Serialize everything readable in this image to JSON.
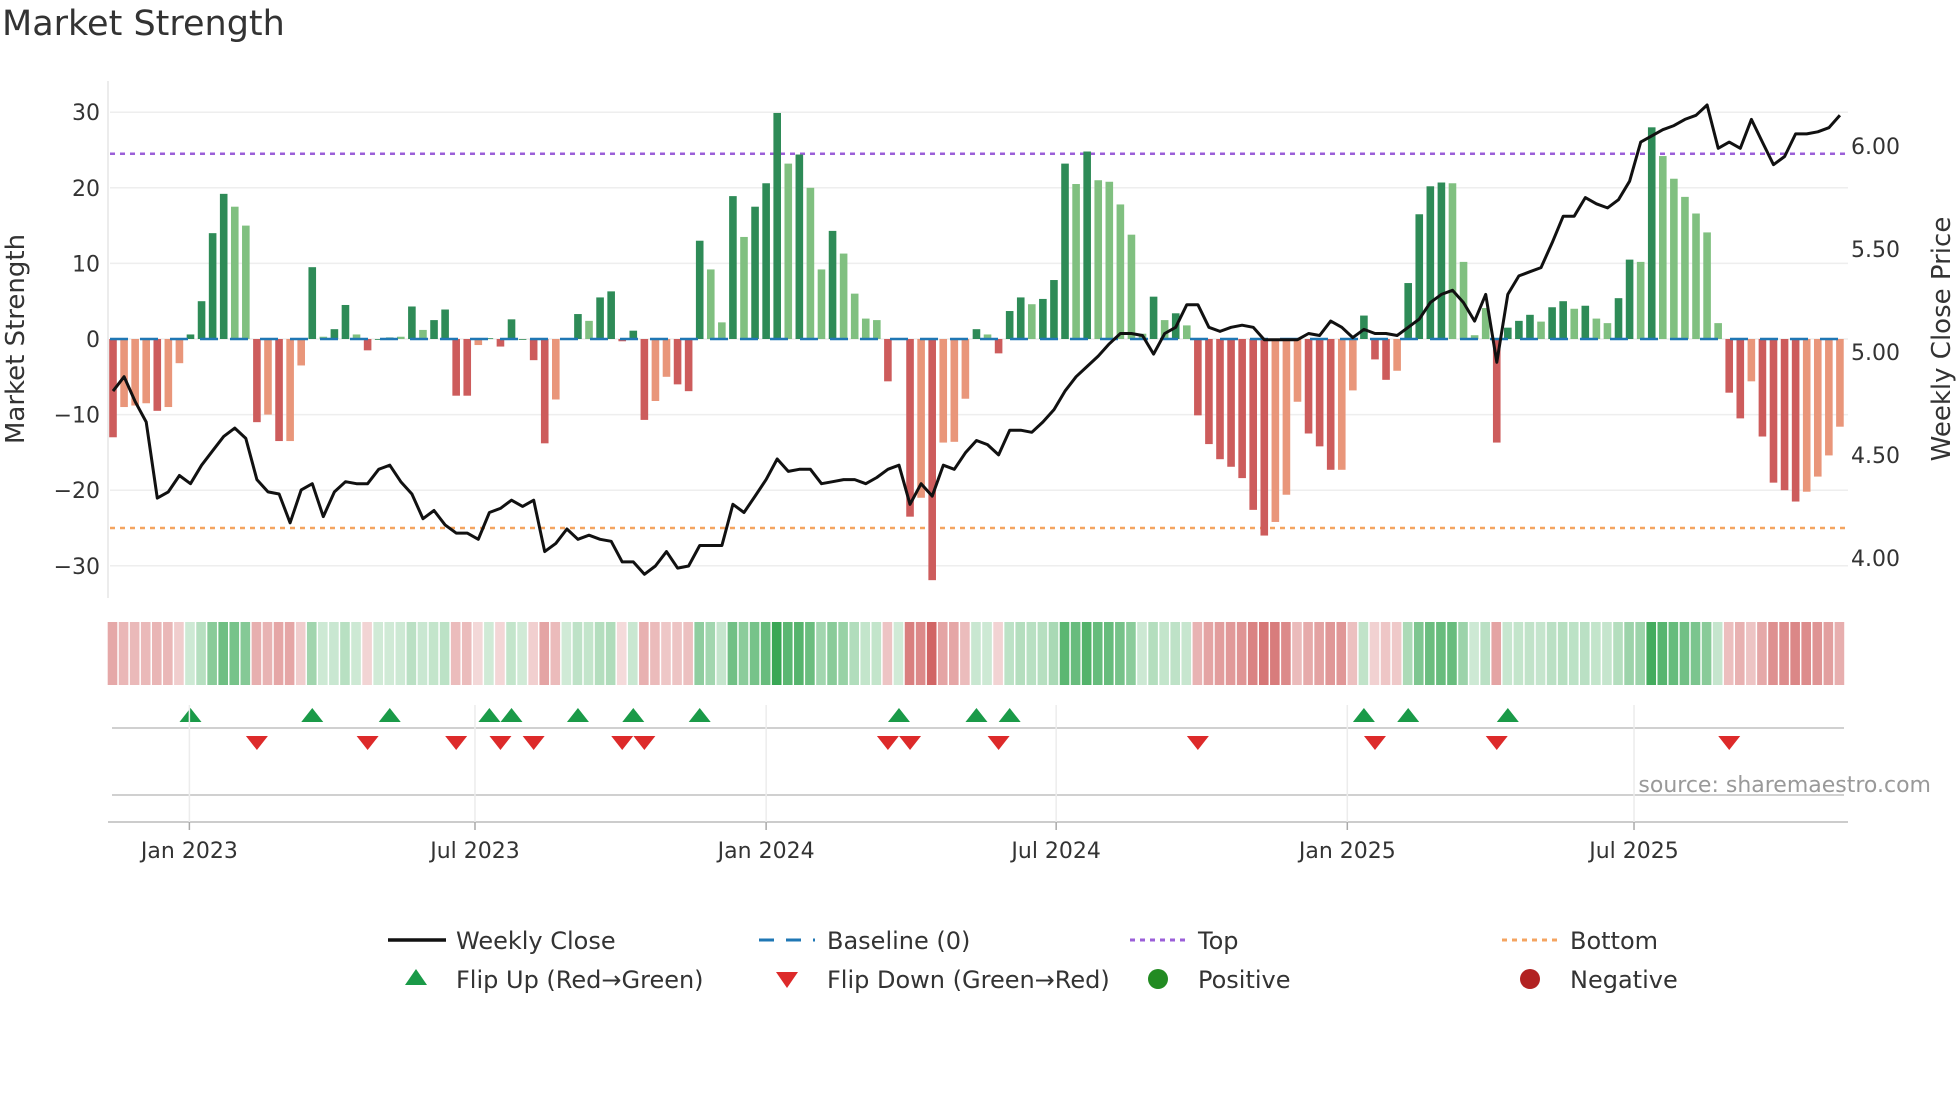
{
  "title": "Market Strength",
  "source": "source: sharemaestro.com",
  "chart_data": {
    "type": "bar",
    "title": "Market Strength",
    "ylabel": "Market Strength",
    "y2label": "Weekly Close Price",
    "ylim": [
      -33,
      33
    ],
    "y2lim": [
      3.9,
      6.3
    ],
    "yticks": [
      -30,
      -20,
      -10,
      0,
      10,
      20,
      30
    ],
    "y2ticks": [
      "4.00",
      "4.50",
      "5.00",
      "5.50",
      "6.00"
    ],
    "xticks": [
      {
        "label": "Jan 2023",
        "week": 6.9
      },
      {
        "label": "Jul 2023",
        "week": 32.7
      },
      {
        "label": "Jan 2024",
        "week": 59.0
      },
      {
        "label": "Jul 2024",
        "week": 85.2
      },
      {
        "label": "Jan 2025",
        "week": 111.5
      },
      {
        "label": "Jul 2025",
        "week": 137.4
      }
    ],
    "top_level": 24.5,
    "bottom_level": -25,
    "strength": [
      -13,
      -9,
      -8.8,
      -8.5,
      -9.5,
      -9,
      -3.2,
      0.6,
      5,
      14,
      19.2,
      17.5,
      15,
      -11,
      -10,
      -13.5,
      -13.5,
      -3.5,
      9.5,
      0.3,
      1.3,
      4.5,
      0.6,
      -1.5,
      0,
      0.2,
      0.3,
      4.3,
      1.2,
      2.5,
      3.9,
      -7.5,
      -7.5,
      -0.8,
      0.1,
      -1,
      2.6,
      0,
      -2.8,
      -13.8,
      -8,
      0,
      3.3,
      2.4,
      5.5,
      6.3,
      -0.3,
      1.1,
      -10.7,
      -8.2,
      -5,
      -6,
      -6.9,
      13,
      9.2,
      2.2,
      18.9,
      13.5,
      17.5,
      20.6,
      29.9,
      23.2,
      24.4,
      20,
      9.2,
      14.3,
      11.3,
      6,
      2.7,
      2.5,
      -5.6,
      0,
      -23.5,
      -21,
      -31.9,
      -13.7,
      -13.6,
      -7.9,
      1.3,
      0.6,
      -1.9,
      3.7,
      5.5,
      4.6,
      5.3,
      7.8,
      23.2,
      20.5,
      24.8,
      21,
      20.8,
      17.8,
      13.8,
      0.7,
      5.6,
      2.5,
      3.4,
      1.8,
      -10.1,
      -13.9,
      -15.9,
      -16.9,
      -18.4,
      -22.6,
      -26,
      -24.2,
      -20.6,
      -8.3,
      -12.5,
      -14.2,
      -17.3,
      -17.3,
      -6.8,
      3.1,
      -2.7,
      -5.4,
      -4.2,
      7.4,
      16.5,
      20.2,
      20.7,
      20.6,
      10.2,
      0.5,
      4.1,
      -13.7,
      1.5,
      2.4,
      3.2,
      2.3,
      4.2,
      5,
      4,
      4.4,
      2.7,
      2.1,
      5.4,
      10.5,
      10.2,
      28,
      24.2,
      21.2,
      18.8,
      16.6,
      14.1,
      2.1,
      -7.1,
      -10.5,
      -5.6,
      -12.9,
      -19,
      -20,
      -21.5,
      -20.2,
      -18.2,
      -15.4,
      -11.6
    ],
    "strong": [
      1,
      0,
      0,
      0,
      1,
      0,
      0,
      1,
      1,
      1,
      1,
      0,
      0,
      1,
      0,
      1,
      0,
      0,
      1,
      0,
      1,
      1,
      0,
      1,
      1,
      1,
      0,
      1,
      0,
      1,
      1,
      1,
      1,
      0,
      1,
      1,
      1,
      1,
      1,
      1,
      0,
      1,
      1,
      0,
      1,
      1,
      1,
      1,
      1,
      0,
      0,
      1,
      1,
      1,
      0,
      0,
      1,
      0,
      1,
      1,
      1,
      0,
      1,
      0,
      0,
      1,
      0,
      0,
      0,
      0,
      1,
      1,
      1,
      0,
      1,
      0,
      0,
      0,
      1,
      0,
      1,
      1,
      1,
      0,
      1,
      1,
      1,
      0,
      1,
      0,
      0,
      0,
      0,
      0,
      1,
      0,
      1,
      0,
      1,
      1,
      1,
      1,
      1,
      1,
      1,
      0,
      0,
      0,
      1,
      1,
      1,
      0,
      0,
      1,
      1,
      1,
      0,
      1,
      1,
      1,
      1,
      0,
      0,
      0,
      0,
      1,
      1,
      1,
      1,
      0,
      1,
      1,
      0,
      1,
      0,
      0,
      1,
      1,
      0,
      1,
      0,
      0,
      0,
      0,
      0,
      0,
      1,
      1,
      0,
      1,
      1,
      1,
      1,
      0,
      0,
      0,
      0
    ],
    "weekly_close": [
      4.81,
      4.88,
      4.76,
      4.66,
      4.29,
      4.32,
      4.4,
      4.36,
      4.45,
      4.52,
      4.59,
      4.63,
      4.58,
      4.38,
      4.32,
      4.31,
      4.17,
      4.33,
      4.36,
      4.2,
      4.32,
      4.37,
      4.36,
      4.36,
      4.43,
      4.45,
      4.37,
      4.31,
      4.19,
      4.23,
      4.16,
      4.12,
      4.12,
      4.09,
      4.22,
      4.24,
      4.28,
      4.25,
      4.28,
      4.03,
      4.07,
      4.14,
      4.09,
      4.11,
      4.09,
      4.08,
      3.98,
      3.98,
      3.92,
      3.96,
      4.03,
      3.95,
      3.96,
      4.06,
      4.06,
      4.06,
      4.26,
      4.22,
      4.3,
      4.38,
      4.48,
      4.42,
      4.43,
      4.43,
      4.36,
      4.37,
      4.38,
      4.38,
      4.36,
      4.39,
      4.43,
      4.45,
      4.26,
      4.36,
      4.3,
      4.45,
      4.43,
      4.51,
      4.57,
      4.55,
      4.5,
      4.62,
      4.62,
      4.61,
      4.66,
      4.72,
      4.81,
      4.88,
      4.93,
      4.98,
      5.04,
      5.09,
      5.09,
      5.08,
      4.99,
      5.09,
      5.12,
      5.23,
      5.23,
      5.12,
      5.1,
      5.12,
      5.13,
      5.12,
      5.06,
      5.06,
      5.06,
      5.06,
      5.09,
      5.08,
      5.15,
      5.12,
      5.07,
      5.11,
      5.09,
      5.09,
      5.08,
      5.12,
      5.16,
      5.24,
      5.28,
      5.3,
      5.24,
      5.15,
      5.28,
      4.95,
      5.28,
      5.37,
      5.39,
      5.41,
      5.53,
      5.66,
      5.66,
      5.75,
      5.72,
      5.7,
      5.74,
      5.83,
      6.02,
      6.05,
      6.08,
      6.1,
      6.13,
      6.15,
      6.2,
      5.99,
      6.02,
      5.99,
      6.13,
      6.02,
      5.91,
      5.95,
      6.06,
      6.06,
      6.07,
      6.09,
      6.15
    ],
    "flip_up_weeks": [
      7,
      18,
      25,
      34,
      36,
      42,
      47,
      53,
      71,
      78,
      81,
      113,
      117,
      126
    ],
    "flip_down_weeks": [
      13,
      23,
      31,
      35,
      38,
      46,
      48,
      70,
      72,
      80,
      98,
      114,
      125,
      146
    ],
    "legend": {
      "position": "bottom",
      "items": [
        {
          "label": "Weekly Close",
          "symbol": "line"
        },
        {
          "label": "Baseline (0)",
          "symbol": "dash"
        },
        {
          "label": "Top",
          "symbol": "dot"
        },
        {
          "label": "Bottom",
          "symbol": "dot"
        },
        {
          "label": "Flip Up (Red→Green)",
          "symbol": "triangle-up"
        },
        {
          "label": "Flip Down (Green→Red)",
          "symbol": "triangle-down"
        },
        {
          "label": "Positive",
          "symbol": "circle"
        },
        {
          "label": "Negative",
          "symbol": "circle"
        }
      ]
    }
  },
  "colors": {
    "pos_strong": "#2e8b57",
    "pos_weak": "#80c080",
    "neg_strong": "#cd5c5c",
    "neg_weak": "#e9967a",
    "line": "#111111",
    "baseline": "#1f77b4",
    "top": "#9b5fd8",
    "bottom": "#f4a460",
    "flip_up": "#1a9a48",
    "flip_down": "#dd2a2a",
    "positive": "#228b22",
    "negative": "#b22222"
  }
}
